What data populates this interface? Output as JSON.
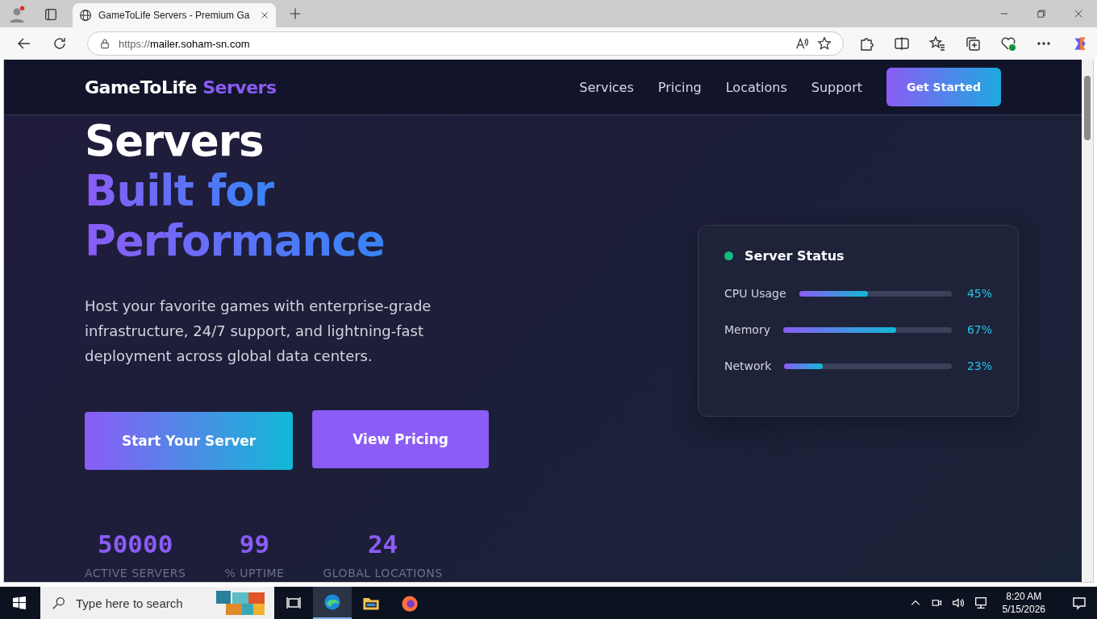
{
  "browser": {
    "tab_title": "GameToLife Servers - Premium Ga",
    "url_scheme": "https://",
    "url_host": "mailer.soham-sn.com"
  },
  "nav": {
    "brand": "GameToLife",
    "brand_accent": "Servers",
    "links": [
      "Services",
      "Pricing",
      "Locations",
      "Support"
    ],
    "cta": "Get Started"
  },
  "hero": {
    "title_lines": [
      {
        "text": "Servers",
        "kind": "plain"
      },
      {
        "text": "Built for",
        "kind": "accent"
      },
      {
        "text": "Performance",
        "kind": "accent"
      }
    ],
    "description": "Host your favorite games with enterprise-grade infrastructure, 24/7 support, and lightning-fast deployment across global data centers.",
    "buttons": [
      {
        "label": "Start Your Server",
        "kind": "gradient"
      },
      {
        "label": "View Pricing",
        "kind": "solid"
      }
    ],
    "stats": [
      {
        "value": "50000",
        "label": "ACTIVE SERVERS"
      },
      {
        "value": "99",
        "label": "% UPTIME"
      },
      {
        "value": "24",
        "label": "GLOBAL LOCATIONS"
      }
    ]
  },
  "status_card": {
    "title": "Server Status",
    "online": true,
    "metrics": [
      {
        "name": "CPU Usage",
        "level": 0.45,
        "reading": "45%"
      },
      {
        "name": "Memory",
        "level": 0.67,
        "reading": "67%"
      },
      {
        "name": "Network",
        "level": 0.23,
        "reading": "23%"
      }
    ]
  },
  "taskbar": {
    "search_placeholder": "Type here to search",
    "time": "8:20 AM",
    "date": "5/15/2026"
  }
}
